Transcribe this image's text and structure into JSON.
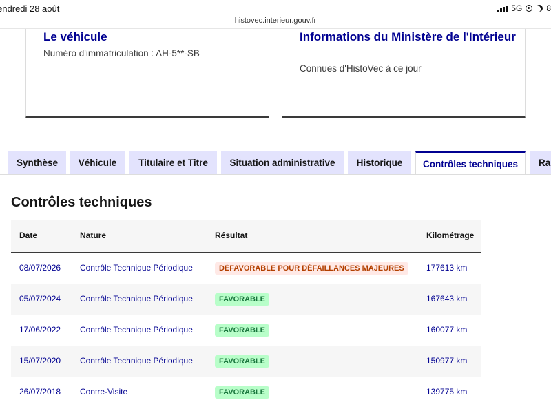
{
  "statusbar": {
    "date": "endredi 28 août",
    "url": "histovec.interieur.gouv.fr",
    "network": "5G",
    "battery": "8"
  },
  "cards": [
    {
      "title": "Le véhicule",
      "description": "Numéro d'immatriculation : AH-5**-SB"
    },
    {
      "title": "Informations du Ministère de l'Intérieur",
      "description": "Connues d'HistoVec à ce jour"
    }
  ],
  "tabs": [
    {
      "label": "Synthèse",
      "active": false
    },
    {
      "label": "Véhicule",
      "active": false
    },
    {
      "label": "Titulaire et Titre",
      "active": false
    },
    {
      "label": "Situation administrative",
      "active": false
    },
    {
      "label": "Historique",
      "active": false
    },
    {
      "label": "Contrôles techniques",
      "active": true
    },
    {
      "label": "Rap",
      "active": false
    }
  ],
  "section": {
    "title": "Contrôles techniques"
  },
  "table": {
    "headers": [
      "Date",
      "Nature",
      "Résultat",
      "Kilométrage"
    ],
    "rows": [
      {
        "date": "08/07/2026",
        "nature": "Contrôle Technique Périodique",
        "result": "DÉFAVORABLE POUR DÉFAILLANCES MAJEURES",
        "result_type": "defavorable",
        "km": "177613 km"
      },
      {
        "date": "05/07/2024",
        "nature": "Contrôle Technique Périodique",
        "result": "FAVORABLE",
        "result_type": "favorable",
        "km": "167643 km"
      },
      {
        "date": "17/06/2022",
        "nature": "Contrôle Technique Périodique",
        "result": "FAVORABLE",
        "result_type": "favorable",
        "km": "160077 km"
      },
      {
        "date": "15/07/2020",
        "nature": "Contrôle Technique Périodique",
        "result": "FAVORABLE",
        "result_type": "favorable",
        "km": "150977 km"
      },
      {
        "date": "26/07/2018",
        "nature": "Contre-Visite",
        "result": "FAVORABLE",
        "result_type": "favorable",
        "km": "139775 km"
      }
    ]
  },
  "colors": {
    "primary": "#000091",
    "tab_bg": "#e3e3fd",
    "favorable_bg": "#b8fec9",
    "favorable_fg": "#18753c",
    "defavorable_bg": "#ffe9e6",
    "defavorable_fg": "#b34000"
  },
  "icons": [
    "signal-icon",
    "location-icon",
    "moon-icon"
  ]
}
